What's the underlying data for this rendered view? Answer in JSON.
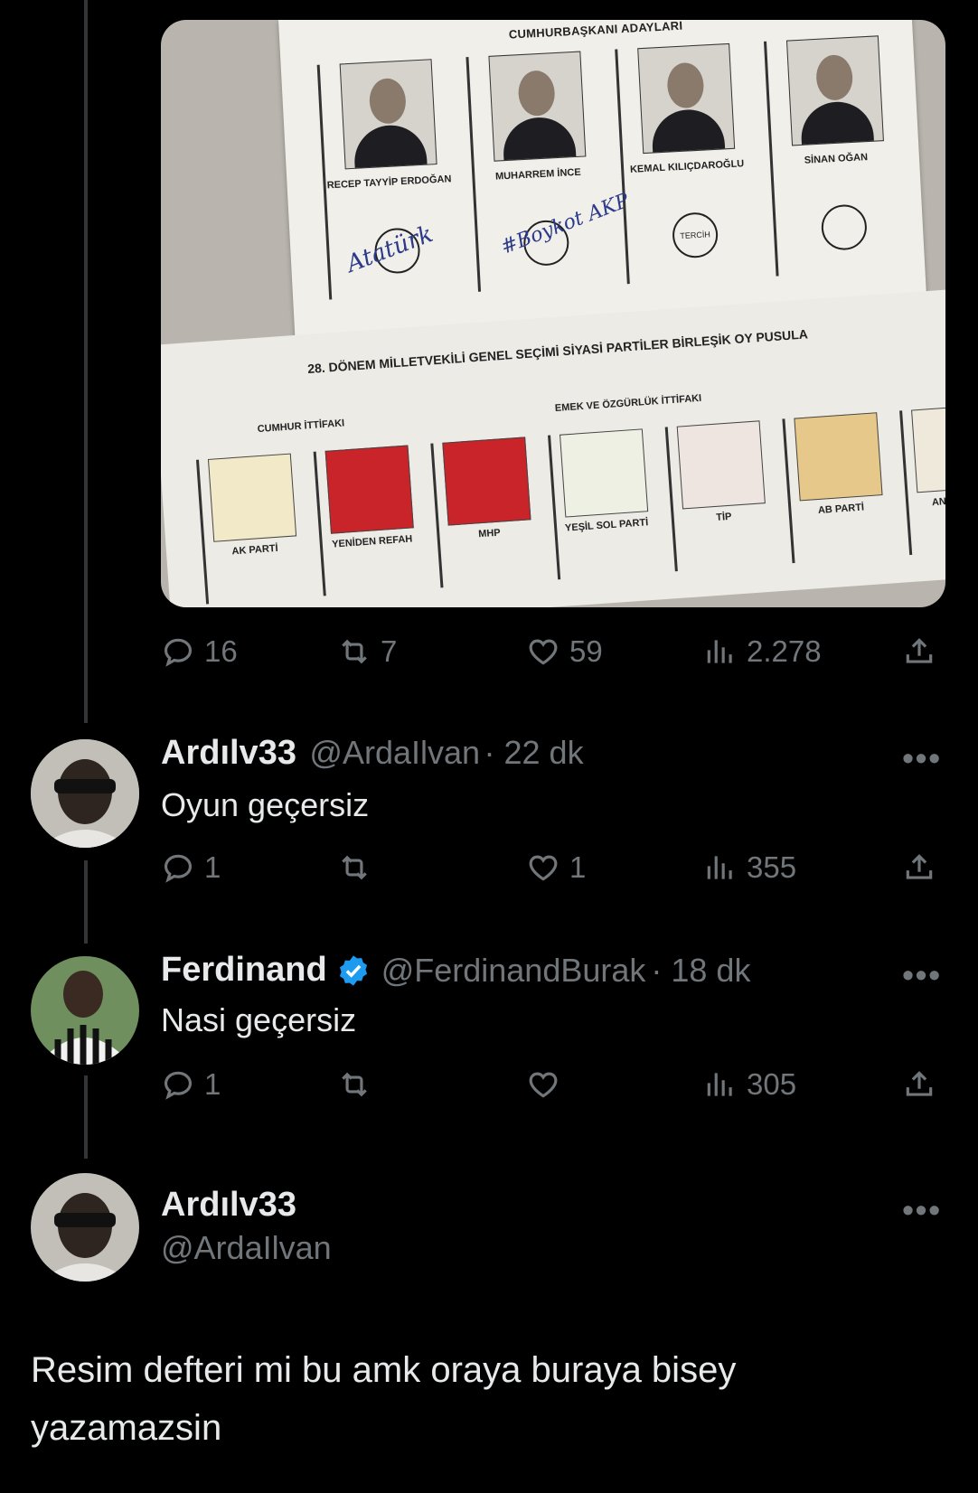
{
  "media": {
    "ballot_top_title": "CUMHURBAŞKANI ADAYLARI",
    "candidates": [
      {
        "name": "RECEP TAYYİP ERDOĞAN",
        "mark": "Atatürk"
      },
      {
        "name": "MUHARREM İNCE",
        "mark": "#Boykot AKP"
      },
      {
        "name": "KEMAL KILIÇDAROĞLU",
        "mark": "TERCİH"
      },
      {
        "name": "SİNAN OĞAN",
        "mark": ""
      }
    ],
    "ballot_bottom_title": "28. DÖNEM MİLLETVEKİLİ GENEL SEÇİMİ SİYASİ PARTİLER BİRLEŞİK OY PUSULA",
    "alliance_left": "CUMHUR İTTİFAKI",
    "alliance_right": "EMEK VE ÖZGÜRLÜK İTTİFAKI",
    "parties": [
      "AK PARTİ",
      "YENİDEN REFAH",
      "MHP",
      "YEŞİL SOL PARTİ",
      "TİP",
      "AB PARTİ",
      "ANAVATAN"
    ]
  },
  "main_tweet_actions": {
    "replies": "16",
    "retweets": "7",
    "likes": "59",
    "views": "2.278"
  },
  "replies": [
    {
      "name": "Ardılv33",
      "handle": "@ArdaIlvan",
      "time": "· 22 dk",
      "text": "Oyun geçersiz",
      "replies": "1",
      "retweets": "",
      "likes": "1",
      "views": "355",
      "verified": false
    },
    {
      "name": "Ferdinand",
      "handle": "@FerdinandBurak",
      "time": "· 18 dk",
      "text": "Nasi geçersiz",
      "replies": "1",
      "retweets": "",
      "likes": "",
      "views": "305",
      "verified": true
    }
  ],
  "focused": {
    "name": "Ardılv33",
    "handle": "@ArdaIlvan",
    "text": "Resim defteri mi bu amk oraya buraya bisey yazamazsin"
  },
  "colors": {
    "background": "#000000",
    "text": "#e7e9ea",
    "muted": "#71767b",
    "verified": "#1d9bf0"
  }
}
